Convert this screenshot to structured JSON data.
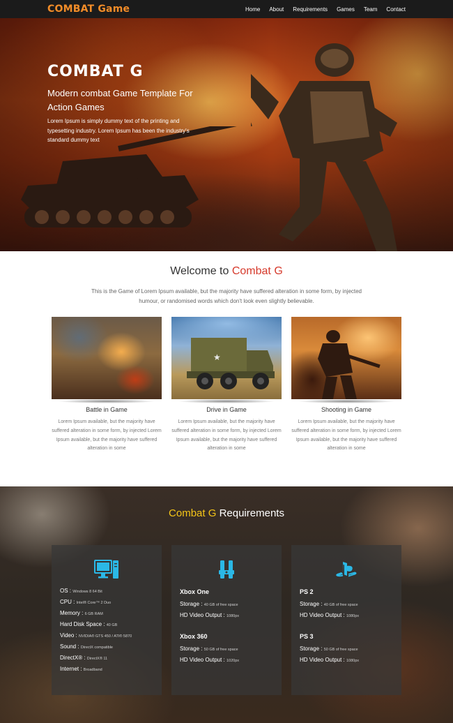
{
  "nav": {
    "logo": "COMBAT Game",
    "items": [
      "Home",
      "About",
      "Requirements",
      "Games",
      "Team",
      "Contact"
    ]
  },
  "hero": {
    "title": "COMBAT G",
    "subtitle": "Modern combat Game Template For Action Games",
    "description": "Lorem Ipsum is simply dummy text of the printing and typesetting industry. Lorem Ipsum has been the industry's standard dummy text"
  },
  "welcome": {
    "title_prefix": "Welcome to ",
    "title_accent": "Combat G",
    "description": "This is the Game of Lorem Ipsum available, but the majority have suffered alteration in some form, by injected humour, or randomised words which don't look even slightly believable.",
    "cards": [
      {
        "title": "Battle in Game",
        "text": "Lorem Ipsum available, but the majority have suffered alteration in some form, by injected Lorem Ipsum available, but the majority have suffered alteration in some"
      },
      {
        "title": "Drive in Game",
        "text": "Lorem Ipsum available, but the majority have suffered alteration in some form, by injected Lorem Ipsum available, but the majority have suffered alteration in some"
      },
      {
        "title": "Shooting in Game",
        "text": "Lorem Ipsum available, but the majority have suffered alteration in some form, by injected Lorem Ipsum available, but the majority have suffered alteration in some"
      }
    ]
  },
  "requirements": {
    "title_accent": "Combat G",
    "title_suffix": " Requirements",
    "pc": {
      "icon": "desktop-computer-icon",
      "specs": [
        {
          "label": "OS : ",
          "value": "Windows 8 64 Bit"
        },
        {
          "label": "CPU : ",
          "value": "Intel® Core™ 2 Duo"
        },
        {
          "label": "Memory : ",
          "value": "6 GB RAM"
        },
        {
          "label": "Hard Disk Space : ",
          "value": "40 GB"
        },
        {
          "label": "Video : ",
          "value": "NVIDIA® GTS 450 / ATI® 5870"
        },
        {
          "label": "Sound : ",
          "value": "DirectX compatible"
        },
        {
          "label": "DirectX® : ",
          "value": "DirectX® 11"
        },
        {
          "label": "Internet : ",
          "value": "Broadband"
        }
      ]
    },
    "xbox": {
      "icon": "xbox-controller-icon",
      "groups": [
        {
          "name": "Xbox One",
          "specs": [
            {
              "label": "Storage : ",
              "value": "40 GB of free space"
            },
            {
              "label": "HD Video Output : ",
              "value": "1080px"
            }
          ]
        },
        {
          "name": "Xbox 360",
          "specs": [
            {
              "label": "Storage : ",
              "value": "50 GB of free space"
            },
            {
              "label": "HD Video Output : ",
              "value": "1020px"
            }
          ]
        }
      ]
    },
    "ps": {
      "icon": "playstation-icon",
      "groups": [
        {
          "name": "PS 2",
          "specs": [
            {
              "label": "Storage : ",
              "value": "40 GB of free space"
            },
            {
              "label": "HD Video Output : ",
              "value": "1080px"
            }
          ]
        },
        {
          "name": "PS 3",
          "specs": [
            {
              "label": "Storage : ",
              "value": "50 GB of free space"
            },
            {
              "label": "HD Video Output : ",
              "value": "1080px"
            }
          ]
        }
      ]
    }
  },
  "colors": {
    "accent_orange": "#f28c28",
    "accent_red": "#d63a2c",
    "accent_yellow": "#f5c518",
    "icon_cyan": "#2bb8e6"
  }
}
